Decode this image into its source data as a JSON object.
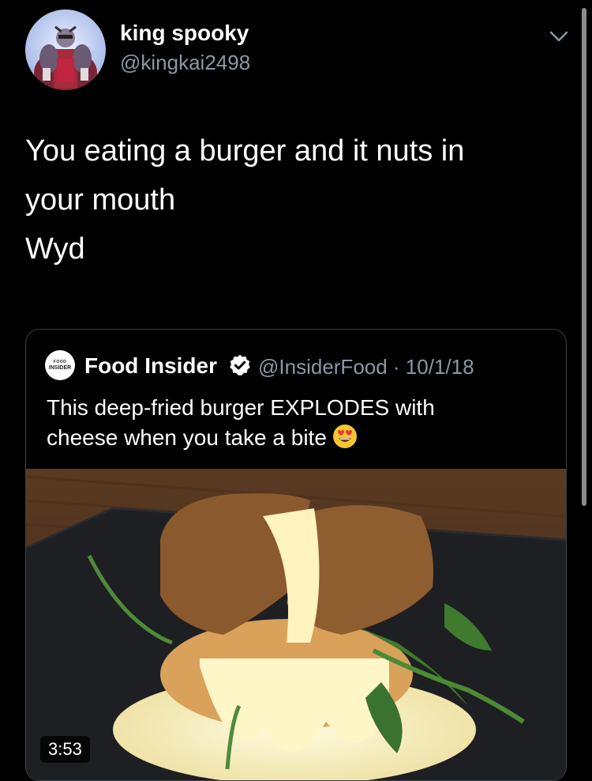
{
  "tweet": {
    "author_name": "king spooky",
    "author_handle": "@kingkai2498",
    "text_lines": [
      "You eating a burger and it nuts in",
      "your mouth",
      "Wyd"
    ]
  },
  "quoted_tweet": {
    "logo_text": [
      "FOOD",
      "INSIDER"
    ],
    "author_name": "Food Insider",
    "handle_and_date": "@InsiderFood · 10/1/18",
    "text_lines": [
      "This deep-fried burger EXPLODES with",
      "cheese when you take a bite"
    ],
    "video_duration": "3:53"
  },
  "icons": {
    "chevron": "chevron-down-icon",
    "verified": "verified-badge-icon",
    "emoji": "heart-eyes-emoji-icon"
  },
  "colors": {
    "background": "#000000",
    "secondary_text": "#8b98a5",
    "verified": "#ffffff",
    "border": "#3a4047"
  }
}
